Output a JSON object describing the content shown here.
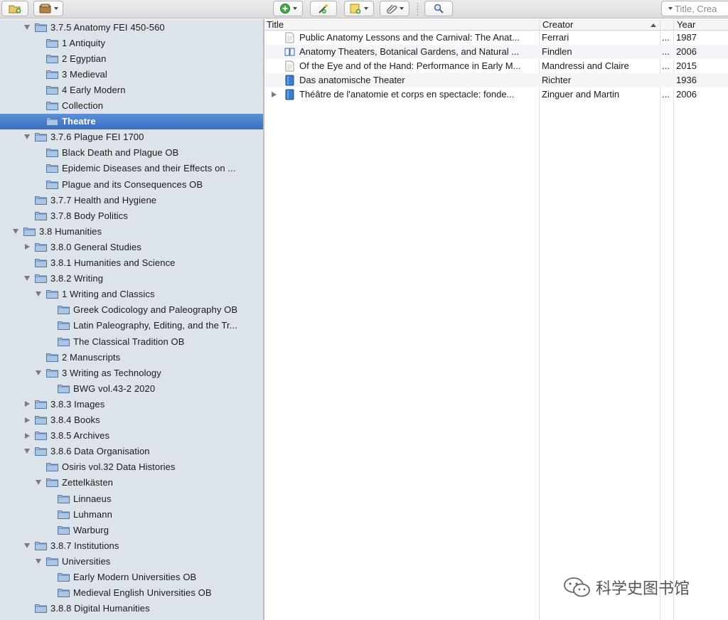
{
  "toolbar": {
    "buttons": [
      {
        "name": "new-collection-button",
        "icon": "folder-plus-icon"
      },
      {
        "name": "new-library-button",
        "icon": "library-icon"
      },
      {
        "name": "new-item-button",
        "icon": "green-plus-icon"
      },
      {
        "name": "add-by-identifier-button",
        "icon": "wand-icon"
      },
      {
        "name": "new-note-button",
        "icon": "note-icon"
      },
      {
        "name": "add-attachment-button",
        "icon": "paperclip-icon"
      },
      {
        "name": "advanced-search-button",
        "icon": "magnifier-icon"
      }
    ],
    "search_placeholder": "Title, Crea"
  },
  "tree": [
    {
      "label": "3.7.5 Anatomy FEI 450-560",
      "level": 2,
      "twisty": "open"
    },
    {
      "label": "1 Antiquity",
      "level": 3,
      "twisty": "none"
    },
    {
      "label": "2 Egyptian",
      "level": 3,
      "twisty": "none"
    },
    {
      "label": "3 Medieval",
      "level": 3,
      "twisty": "none"
    },
    {
      "label": "4 Early Modern",
      "level": 3,
      "twisty": "none"
    },
    {
      "label": "Collection",
      "level": 3,
      "twisty": "none"
    },
    {
      "label": "Theatre",
      "level": 3,
      "twisty": "none",
      "selected": true
    },
    {
      "label": "3.7.6 Plague FEI 1700",
      "level": 2,
      "twisty": "open"
    },
    {
      "label": "Black Death and Plague OB",
      "level": 3,
      "twisty": "none"
    },
    {
      "label": "Epidemic Diseases and their Effects on ...",
      "level": 3,
      "twisty": "none"
    },
    {
      "label": "Plague and its Consequences OB",
      "level": 3,
      "twisty": "none"
    },
    {
      "label": "3.7.7 Health and Hygiene",
      "level": 2,
      "twisty": "none"
    },
    {
      "label": "3.7.8 Body Politics",
      "level": 2,
      "twisty": "none"
    },
    {
      "label": "3.8 Humanities",
      "level": 1,
      "twisty": "open"
    },
    {
      "label": "3.8.0 General Studies",
      "level": 2,
      "twisty": "closed"
    },
    {
      "label": "3.8.1 Humanities and Science",
      "level": 2,
      "twisty": "none"
    },
    {
      "label": "3.8.2 Writing",
      "level": 2,
      "twisty": "open"
    },
    {
      "label": "1 Writing and Classics",
      "level": 3,
      "twisty": "open"
    },
    {
      "label": "Greek Codicology and Paleography OB",
      "level": 4,
      "twisty": "none"
    },
    {
      "label": "Latin Paleography, Editing, and the Tr...",
      "level": 4,
      "twisty": "none"
    },
    {
      "label": "The Classical Tradition OB",
      "level": 4,
      "twisty": "none"
    },
    {
      "label": "2 Manuscripts",
      "level": 3,
      "twisty": "none"
    },
    {
      "label": "3 Writing as Technology",
      "level": 3,
      "twisty": "open"
    },
    {
      "label": "BWG vol.43-2 2020",
      "level": 4,
      "twisty": "none"
    },
    {
      "label": "3.8.3 Images",
      "level": 2,
      "twisty": "closed"
    },
    {
      "label": "3.8.4 Books",
      "level": 2,
      "twisty": "closed"
    },
    {
      "label": "3.8.5 Archives",
      "level": 2,
      "twisty": "closed"
    },
    {
      "label": "3.8.6 Data Organisation",
      "level": 2,
      "twisty": "open"
    },
    {
      "label": "Osiris vol.32 Data Histories",
      "level": 3,
      "twisty": "none"
    },
    {
      "label": "Zettelkästen",
      "level": 3,
      "twisty": "open"
    },
    {
      "label": "Linnaeus",
      "level": 4,
      "twisty": "none"
    },
    {
      "label": "Luhmann",
      "level": 4,
      "twisty": "none"
    },
    {
      "label": "Warburg",
      "level": 4,
      "twisty": "none"
    },
    {
      "label": "3.8.7 Institutions",
      "level": 2,
      "twisty": "open"
    },
    {
      "label": "Universities",
      "level": 3,
      "twisty": "open"
    },
    {
      "label": "Early Modern Universities OB",
      "level": 4,
      "twisty": "none"
    },
    {
      "label": "Medieval English Universities OB",
      "level": 4,
      "twisty": "none"
    },
    {
      "label": "3.8.8 Digital Humanities",
      "level": 2,
      "twisty": "none"
    }
  ],
  "columns": {
    "title": "Title",
    "creator": "Creator",
    "extra": "",
    "year": "Year"
  },
  "items": [
    {
      "icon": "journal-article-icon",
      "title": "Public Anatomy Lessons and the Carnival: The Anat...",
      "creator": "Ferrari",
      "extra": "...",
      "year": "1987",
      "twisty": false
    },
    {
      "icon": "book-section-icon",
      "title": "Anatomy Theaters, Botanical Gardens, and Natural ...",
      "creator": "Findlen",
      "extra": "...",
      "year": "2006",
      "twisty": false
    },
    {
      "icon": "journal-article-icon",
      "title": "Of the Eye and of the Hand: Performance in Early M...",
      "creator": "Mandressi and Claire",
      "extra": "...",
      "year": "2015",
      "twisty": false
    },
    {
      "icon": "book-icon",
      "title": "Das anatomische Theater",
      "creator": "Richter",
      "extra": "",
      "year": "1936",
      "twisty": false
    },
    {
      "icon": "book-icon",
      "title": "Théâtre de l'anatomie et corps en spectacle: fonde...",
      "creator": "Zinguer and Martin",
      "extra": "...",
      "year": "2006",
      "twisty": true
    }
  ],
  "watermark": {
    "text": "科学史图书馆",
    "icon": "wechat-icon"
  },
  "colors": {
    "sidebar_bg": "#dde3ea",
    "selection": "#3a6fc1",
    "folder": "#8fb3d9"
  }
}
